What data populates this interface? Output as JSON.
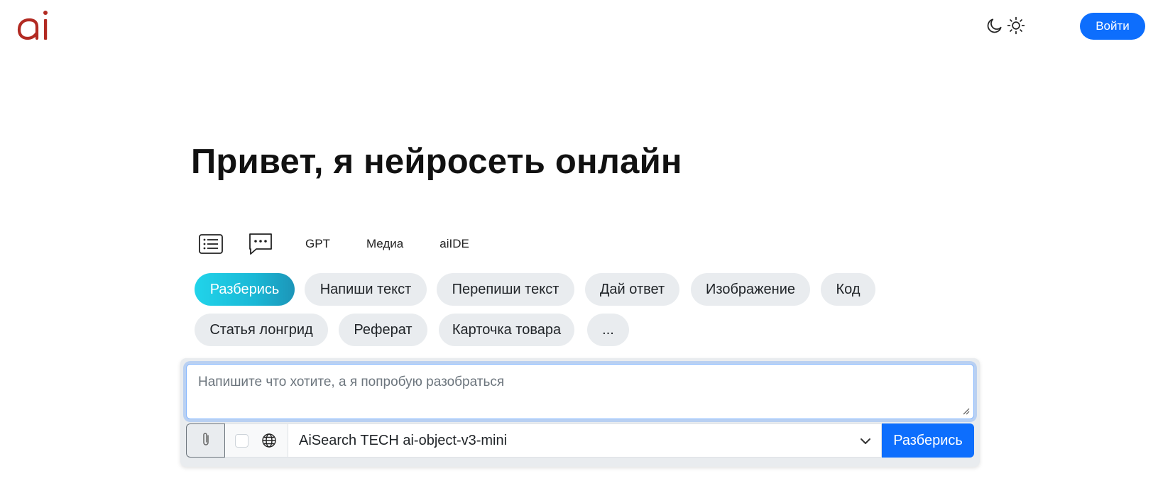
{
  "header": {
    "logo_text": "ai",
    "brand_color": "#b22a22",
    "theme_dark_icon": "moon-icon",
    "theme_light_icon": "sun-icon",
    "login_label": "Войти"
  },
  "hero": {
    "title": "Привет, я нейросеть онлайн"
  },
  "tabs": [
    {
      "icon": "list-icon"
    },
    {
      "icon": "chat-icon"
    },
    {
      "label": "GPT"
    },
    {
      "label": "Медиа"
    },
    {
      "label": "aiIDE"
    }
  ],
  "chips": [
    {
      "label": "Разберись",
      "active": true
    },
    {
      "label": "Напиши текст"
    },
    {
      "label": "Перепиши текст"
    },
    {
      "label": "Дай ответ"
    },
    {
      "label": "Изображение"
    },
    {
      "label": "Код"
    },
    {
      "label": "Статья лонгрид"
    },
    {
      "label": "Реферат"
    },
    {
      "label": "Карточка товара"
    },
    {
      "label": "..."
    }
  ],
  "composer": {
    "placeholder": "Напишите что хотите, а я попробую разобраться",
    "attach_icon": "paperclip-icon",
    "web_icon": "globe-icon",
    "model": "AiSearch TECH ai-object-v3-mini",
    "submit_label": "Разберись"
  },
  "colors": {
    "accent": "#0d6efd",
    "chip_bg": "#e9ecef",
    "active_chip_gradient": [
      "#21d4ea",
      "#1c95b8"
    ]
  }
}
